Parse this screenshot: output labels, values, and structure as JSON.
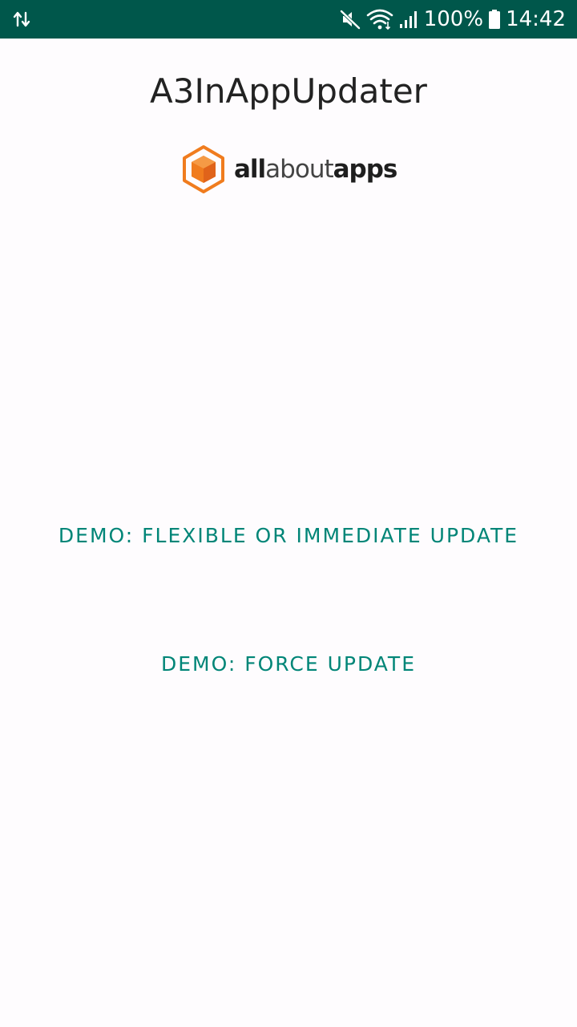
{
  "status_bar": {
    "left_icon": "data-transfer-icon",
    "icons": [
      "mute-icon",
      "wifi-icon",
      "signal-icon",
      "battery-icon"
    ],
    "battery_percent": "100%",
    "time": "14:42",
    "background_color": "#00574b"
  },
  "app": {
    "title": "A3InAppUpdater"
  },
  "logo": {
    "part1": "all",
    "part2": "about",
    "part3": "apps",
    "brand_color": "#f07c1e"
  },
  "buttons": {
    "flexible_label": "DEMO: FLEXIBLE OR IMMEDIATE UPDATE",
    "force_label": "DEMO: FORCE UPDATE",
    "accent_color": "#008577"
  }
}
